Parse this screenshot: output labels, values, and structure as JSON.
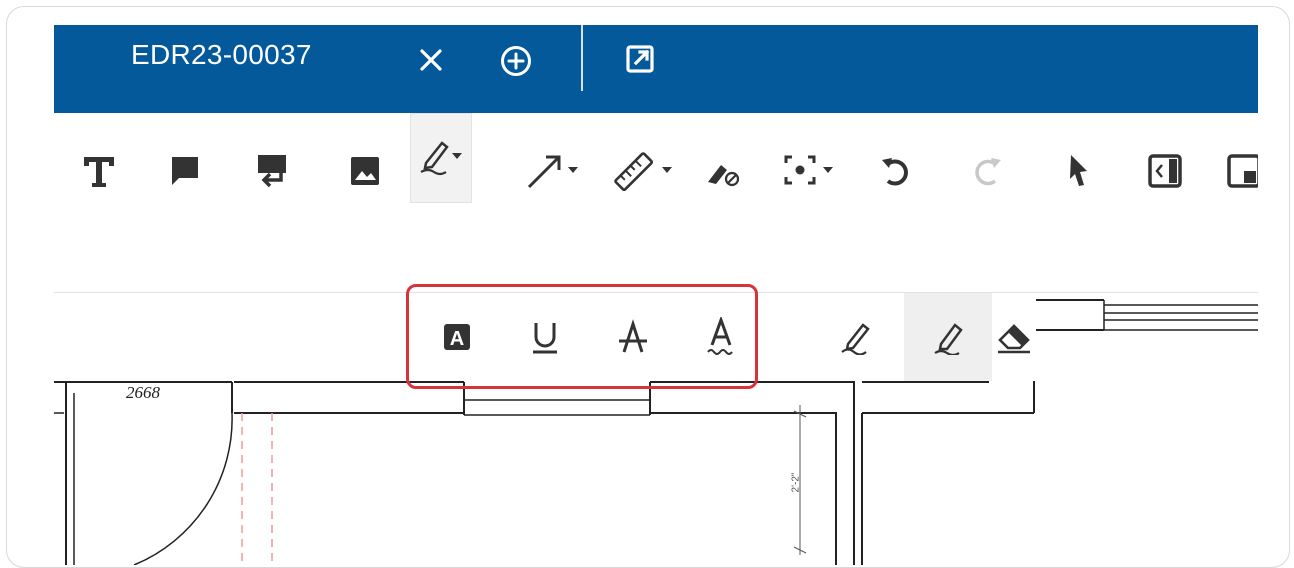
{
  "tab": {
    "title": "EDR23-00037",
    "icons": [
      "close-icon",
      "add-circle-icon",
      "open-external-icon"
    ]
  },
  "toolbar": {
    "tools": [
      {
        "name": "text-tool",
        "icon": "text-T-icon"
      },
      {
        "name": "comment-tool",
        "icon": "speech-bubble-icon"
      },
      {
        "name": "callout-tool",
        "icon": "callout-icon"
      },
      {
        "name": "image-tool",
        "icon": "image-icon"
      },
      {
        "name": "markup-tool",
        "icon": "highlighter-dropdown-icon",
        "active": true
      },
      {
        "name": "arrow-tool",
        "icon": "arrow-dropdown-icon"
      },
      {
        "name": "measure-tool",
        "icon": "ruler-dropdown-icon"
      },
      {
        "name": "erase-markup-tool",
        "icon": "eraser-cancel-icon"
      },
      {
        "name": "capture-tool",
        "icon": "focus-dropdown-icon"
      },
      {
        "name": "undo",
        "icon": "undo-icon"
      },
      {
        "name": "redo",
        "icon": "redo-icon",
        "disabled": true
      },
      {
        "name": "select-tool",
        "icon": "pointer-icon"
      },
      {
        "name": "collapse-panel",
        "icon": "panel-left-icon"
      },
      {
        "name": "panel-toggle",
        "icon": "panel-icon"
      }
    ]
  },
  "subtoolbar": {
    "items": [
      {
        "name": "text-highlight",
        "glyph": "A"
      },
      {
        "name": "text-underline",
        "glyph": "U"
      },
      {
        "name": "text-strikethrough",
        "glyph": "A"
      },
      {
        "name": "text-squiggly",
        "glyph": "A"
      },
      {
        "name": "freehand-pen",
        "icon": "pen-icon"
      },
      {
        "name": "freehand-highlighter",
        "icon": "highlighter-icon",
        "active": true
      },
      {
        "name": "eraser",
        "icon": "eraser-icon"
      }
    ]
  },
  "drawing": {
    "door_label": "2668",
    "dimension_label": "2'-2\""
  },
  "colors": {
    "header": "#03599a",
    "highlight_box": "#d6333a",
    "icon": "#333333"
  }
}
